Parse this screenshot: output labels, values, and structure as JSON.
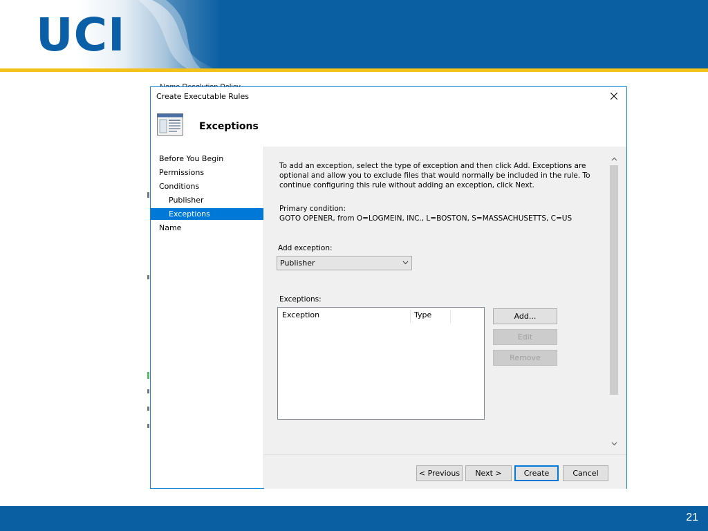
{
  "slide": {
    "logo_text": "UCI",
    "page_number": "21",
    "colors": {
      "brand_blue": "#0a5fa3",
      "gold": "#f2c21b"
    }
  },
  "background_app": {
    "title": "Name Resolution Policy"
  },
  "dialog": {
    "title": "Create Executable Rules",
    "heading": "Exceptions",
    "close_icon": "close-icon",
    "nav": {
      "items": [
        {
          "label": "Before You Begin",
          "indent": false,
          "selected": false
        },
        {
          "label": "Permissions",
          "indent": false,
          "selected": false
        },
        {
          "label": "Conditions",
          "indent": false,
          "selected": false
        },
        {
          "label": "Publisher",
          "indent": true,
          "selected": false
        },
        {
          "label": "Exceptions",
          "indent": true,
          "selected": true
        },
        {
          "label": "Name",
          "indent": false,
          "selected": false
        }
      ]
    },
    "content": {
      "intro_lines": [
        "To add an exception, select the type of exception and then click Add. Exceptions are",
        "optional and allow you to exclude files that would normally be included in the rule. To",
        "continue configuring this rule without adding an exception, click Next."
      ],
      "primary_condition_label": "Primary condition:",
      "primary_condition_value": "GOTO OPENER, from O=LOGMEIN, INC., L=BOSTON, S=MASSACHUSETTS, C=US",
      "add_exception_label": "Add exception:",
      "add_exception_value": "Publisher",
      "exceptions_label": "Exceptions:",
      "columns": [
        "Exception",
        "Type"
      ],
      "buttons": {
        "add": "Add...",
        "edit": "Edit",
        "remove": "Remove"
      }
    },
    "footer_buttons": {
      "previous": "< Previous",
      "next": "Next >",
      "create": "Create",
      "cancel": "Cancel"
    }
  }
}
